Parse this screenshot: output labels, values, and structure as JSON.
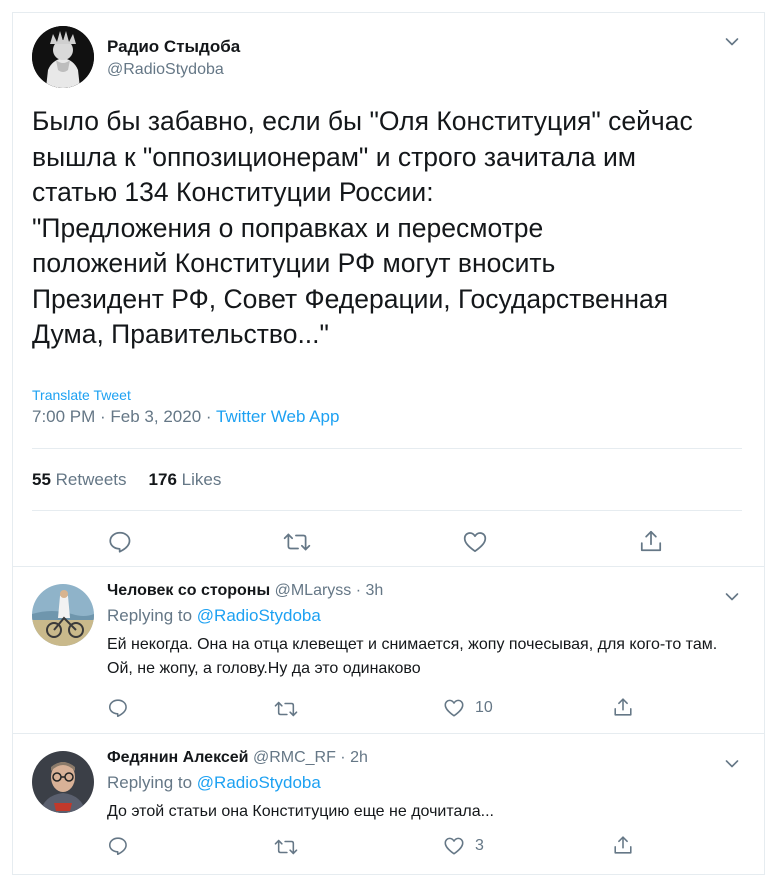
{
  "main": {
    "author_name": "Радио Стыдоба",
    "author_handle": "@RadioStydoba",
    "text": "Было бы забавно, если бы \"Оля Конституция\" сейчас\nвышла к \"оппозиционерам\" и строго зачитала им\nстатью 134 Конституции России:\n\"Предложения о поправках и пересмотре\nположений Конституции РФ могут вносить\nПрезидент РФ, Совет Федерации, Государственная\nДума, Правительство...\"",
    "translate_label": "Translate Tweet",
    "timestamp": "7:00 PM · Feb 3, 2020 · ",
    "source_app": "Twitter Web App",
    "retweets_count": "55",
    "retweets_label": "Retweets",
    "likes_count": "176",
    "likes_label": "Likes"
  },
  "replies": [
    {
      "author_name": "Человек со стороны",
      "author_handle": "@MLaryss",
      "time": "3h",
      "replying_prefix": "Replying to ",
      "replying_to": "@RadioStydoba",
      "text": "Ей некогда. Она на отца клевещет и снимается, жопу почесывая, для кого-то там. Ой, не жопу, а голову.Ну да это одинаково",
      "likes": "10"
    },
    {
      "author_name": "Федянин Алексей",
      "author_handle": "@RMC_RF",
      "time": "2h",
      "replying_prefix": "Replying to ",
      "replying_to": "@RadioStydoba",
      "text": "До этой статьи она Конституцию еще не дочитала...",
      "likes": "3"
    }
  ],
  "icons": {
    "reply": "reply-icon",
    "retweet": "retweet-icon",
    "like": "heart-icon",
    "share": "share-icon",
    "more": "chevron-down-icon"
  },
  "colors": {
    "accent": "#1da1f2",
    "secondary_text": "#657786",
    "primary_text": "#14171a",
    "border": "#e6ecf0"
  }
}
